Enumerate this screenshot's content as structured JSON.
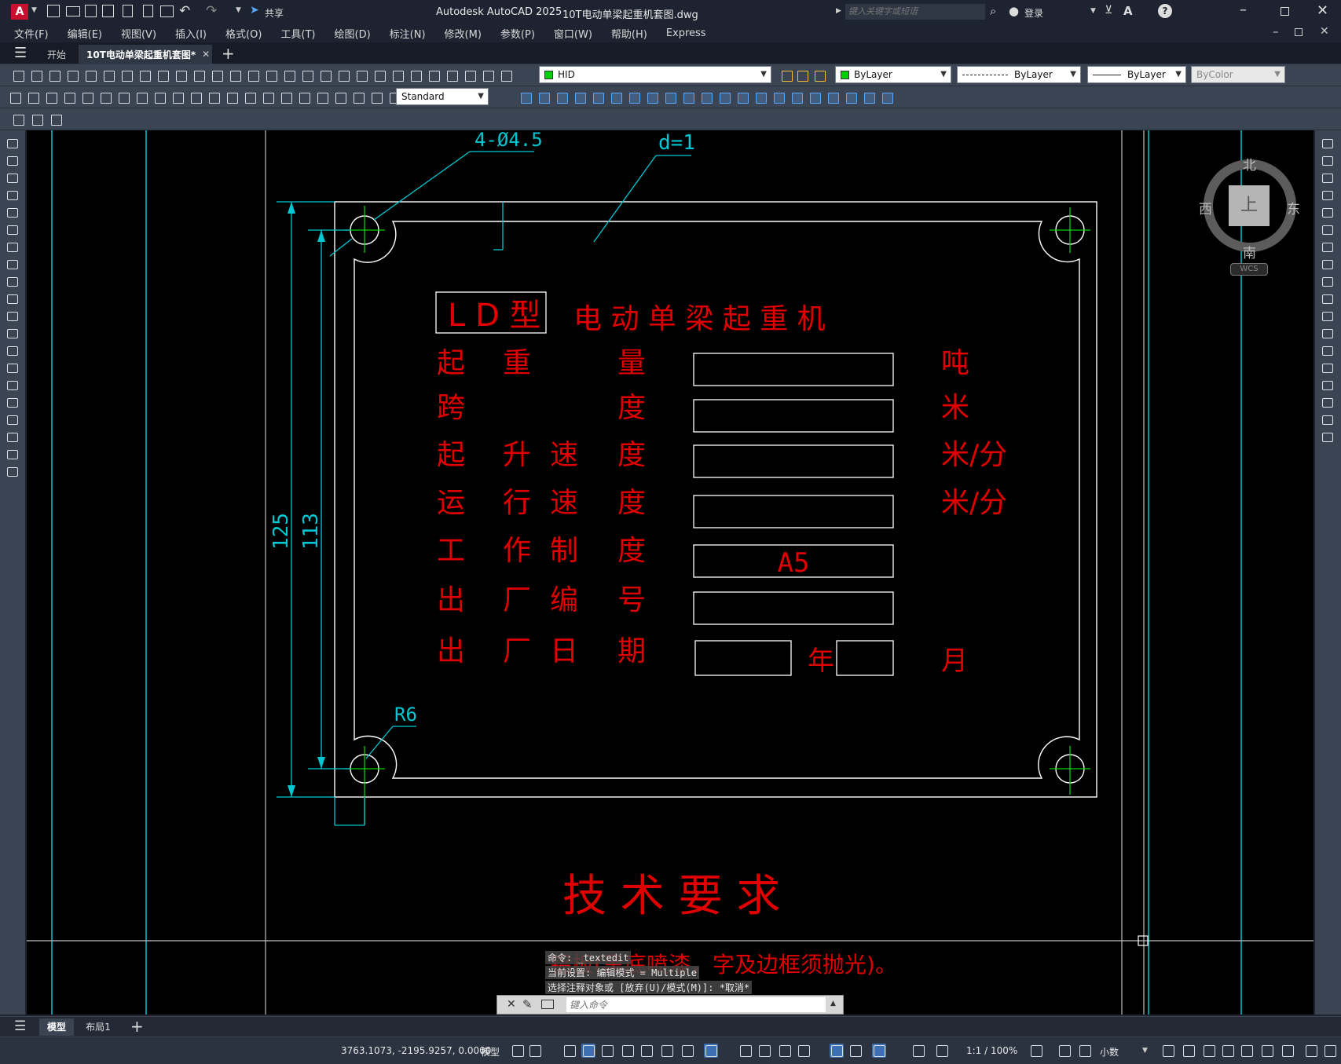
{
  "title": {
    "app_name": "Autodesk AutoCAD 2025",
    "file_name": "10T电动单梁起重机套图.dwg",
    "search_placeholder": "键入关键字或短语",
    "login": "登录",
    "share": "共享",
    "app_badge": "A"
  },
  "menu": [
    "文件(F)",
    "编辑(E)",
    "视图(V)",
    "插入(I)",
    "格式(O)",
    "工具(T)",
    "绘图(D)",
    "标注(N)",
    "修改(M)",
    "参数(P)",
    "窗口(W)",
    "帮助(H)",
    "Express"
  ],
  "tabs": {
    "start": "开始",
    "document": "10T电动单梁起重机套图*"
  },
  "toolbar": {
    "layer": "HID",
    "color": "ByLayer",
    "linetype": "ByLayer",
    "lineweight": "ByLayer",
    "plotstyle": "ByColor",
    "textstyle": "Standard"
  },
  "viewcube": {
    "north": "北",
    "south": "南",
    "west": "西",
    "east": "东",
    "face": "上",
    "wcs": "WCS"
  },
  "drawing": {
    "dims": {
      "holes": "4-Ø4.5",
      "thickness": "d=1",
      "height_outer": "125",
      "height_inner": "113",
      "radius": "R6"
    },
    "plate_title": {
      "model": "L D 型",
      "name": "电 动 单 梁 起 重 机"
    },
    "rows": [
      {
        "a": "起",
        "b": "重",
        "c": "",
        "d": "量",
        "value": "",
        "unit": "吨"
      },
      {
        "a": "跨",
        "b": "",
        "c": "",
        "d": "度",
        "value": "",
        "unit": "米"
      },
      {
        "a": "起",
        "b": "升",
        "c": "速",
        "d": "度",
        "value": "",
        "unit": "米/分"
      },
      {
        "a": "运",
        "b": "行",
        "c": "速",
        "d": "度",
        "value": "",
        "unit": "米/分"
      },
      {
        "a": "工",
        "b": "作",
        "c": "制",
        "d": "度",
        "value": "A5",
        "unit": ""
      },
      {
        "a": "出",
        "b": "厂",
        "c": "编",
        "d": "号",
        "value": "",
        "unit": ""
      },
      {
        "a": "出",
        "b": "厂",
        "c": "日",
        "d": "期",
        "value": "",
        "unit": ""
      }
    ],
    "date_year": "年",
    "date_month": "月",
    "tech_title": "技 术 要 求",
    "tech_note": "铝板(黑底喷漆，字及边框须抛光)。"
  },
  "command": {
    "history": [
      "命令: _textedit",
      "当前设置: 编辑模式 = Multiple",
      "选择注释对象或 [放弃(U)/模式(M)]: *取消*"
    ],
    "placeholder": "键入命令"
  },
  "layout_tabs": [
    "模型",
    "布局1"
  ],
  "status": {
    "coords": "3763.1073, -2195.9257, 0.0000",
    "model": "模型",
    "scale": "1:1 / 100%",
    "units": "小数"
  },
  "colors": {
    "canvas": "#000000",
    "red_text": "#e00000",
    "cyan_dim": "#00c8d2",
    "green_center": "#00d000",
    "white_line": "#ffffff",
    "ui_bg": "#1d2330",
    "toolbar_bg": "#3b4453"
  }
}
